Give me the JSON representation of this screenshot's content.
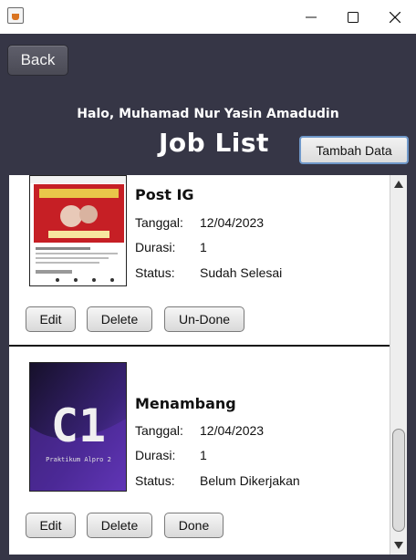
{
  "window": {
    "app_icon": "java-cup-icon",
    "controls": [
      "minimize-icon",
      "maximize-icon",
      "close-icon"
    ]
  },
  "header": {
    "back_label": "Back",
    "greeting": "Halo, Muhamad Nur Yasin Amadudin",
    "title": "Job List",
    "add_label": "Tambah Data"
  },
  "jobs": [
    {
      "title": "Post IG",
      "tanggal_label": "Tanggal:",
      "tanggal": "12/04/2023",
      "durasi_label": "Durasi:",
      "durasi": "1",
      "status_label": "Status:",
      "status": "Sudah Selesai",
      "thumb_text": "",
      "buttons": {
        "edit": "Edit",
        "delete": "Delete",
        "toggle": "Un-Done"
      }
    },
    {
      "title": "Menambang",
      "tanggal_label": "Tanggal:",
      "tanggal": "12/04/2023",
      "durasi_label": "Durasi:",
      "durasi": "1",
      "status_label": "Status:",
      "status": "Belum Dikerjakan",
      "thumb_big": "C1",
      "thumb_caption": "Praktikum Alpro 2",
      "buttons": {
        "edit": "Edit",
        "delete": "Delete",
        "toggle": "Done"
      }
    }
  ],
  "colors": {
    "background": "#363646",
    "panel": "#ffffff",
    "accent_border": "#6f98c9"
  }
}
